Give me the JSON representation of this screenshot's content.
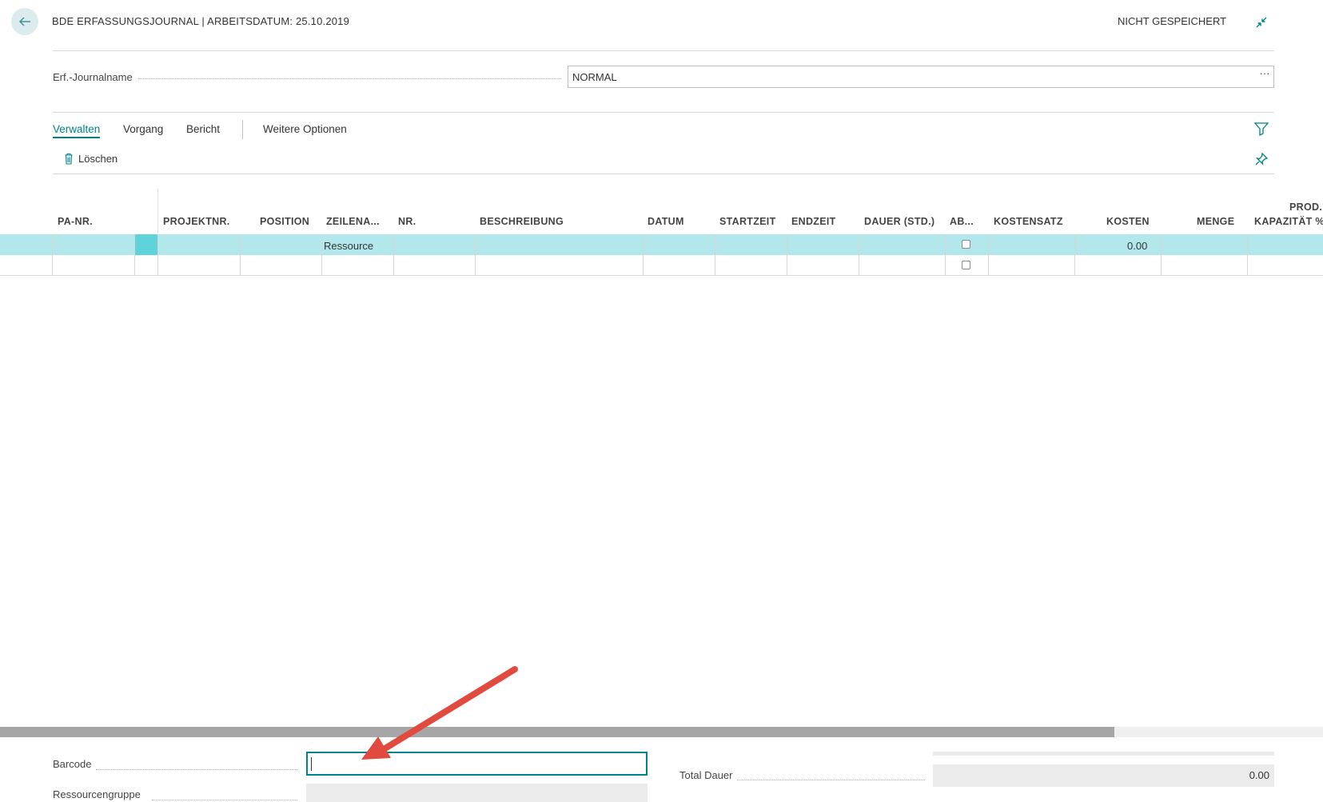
{
  "header": {
    "title": "BDE ERFASSUNGSJOURNAL | ARBEITSDATUM: 25.10.2019",
    "status": "NICHT GESPEICHERT"
  },
  "journal": {
    "label": "Erf.-Journalname",
    "value": "NORMAL",
    "lookup": "···"
  },
  "actions": {
    "tabs": [
      "Verwalten",
      "Vorgang",
      "Bericht",
      "Weitere Optionen"
    ],
    "delete_label": "Löschen"
  },
  "table": {
    "columns": [
      "PA-NR.",
      "PROJEKTNR.",
      "POSITION",
      "ZEILENA...",
      "NR.",
      "BESCHREIBUNG",
      "DATUM",
      "STARTZEIT",
      "ENDZEIT",
      "DAUER (STD.)",
      "AB...",
      "KOSTENSATZ",
      "KOSTEN",
      "MENGE",
      "PROD.",
      "KAPAZITÄT %"
    ],
    "rows": [
      {
        "zeilenart": "Ressource",
        "kosten": "0.00",
        "ab_checked": false
      },
      {
        "zeilenart": "",
        "kosten": "",
        "ab_checked": false
      }
    ]
  },
  "footer": {
    "barcode_label": "Barcode",
    "barcode_value": "",
    "group_label": "Ressourcengruppe",
    "total_label": "Total Dauer",
    "total_value": "0.00"
  },
  "colors": {
    "accent": "#00838a",
    "selected_row": "#b2e8ec",
    "selected_cell": "#5fd3da",
    "annotation_arrow": "#e04a3f"
  }
}
